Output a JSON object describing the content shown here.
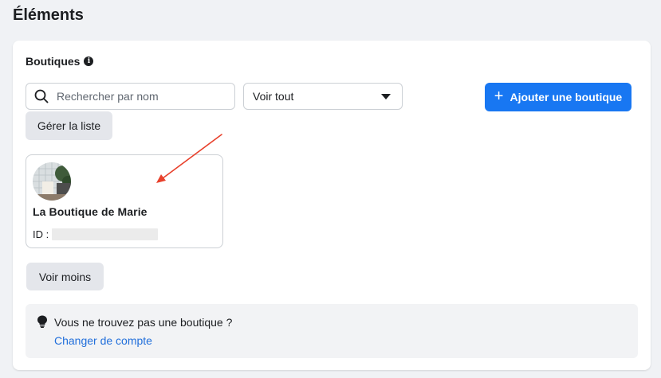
{
  "page": {
    "title": "Éléments"
  },
  "section": {
    "title": "Boutiques",
    "info_icon": "info-icon"
  },
  "search": {
    "placeholder": "Rechercher par nom",
    "value": ""
  },
  "filter": {
    "selected": "Voir tout"
  },
  "buttons": {
    "add_shop": "Ajouter une boutique",
    "manage_list": "Gérer la liste",
    "show_less": "Voir moins"
  },
  "shop": {
    "name": "La Boutique de Marie",
    "id_label": "ID :"
  },
  "notice": {
    "text": "Vous ne trouvez pas une boutique ?",
    "link": "Changer de compte"
  },
  "colors": {
    "accent": "#1877f2",
    "link": "#216fdb",
    "annotation_arrow": "#e8412c"
  }
}
